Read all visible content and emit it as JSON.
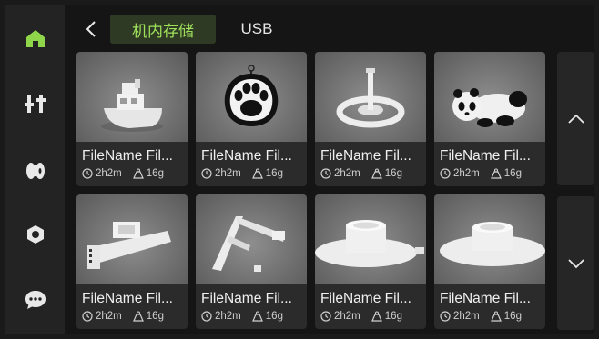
{
  "sidebar": {
    "items": [
      {
        "icon": "home-icon",
        "active": true
      },
      {
        "icon": "sliders-icon",
        "active": false
      },
      {
        "icon": "filament-spool-icon",
        "active": false
      },
      {
        "icon": "nut-settings-icon",
        "active": false
      },
      {
        "icon": "chat-bubble-icon",
        "active": false
      }
    ]
  },
  "header": {
    "tabs": [
      {
        "label": "机内存储",
        "active": true
      },
      {
        "label": "USB",
        "active": false
      }
    ]
  },
  "files": [
    {
      "name": "FileName Fil...",
      "time": "2h2m",
      "weight": "16g",
      "preview": "benchy-boat"
    },
    {
      "name": "FileName Fil...",
      "time": "2h2m",
      "weight": "16g",
      "preview": "paw-keychain"
    },
    {
      "name": "FileName Fil...",
      "time": "2h2m",
      "weight": "16g",
      "preview": "spinning-top"
    },
    {
      "name": "FileName Fil...",
      "time": "2h2m",
      "weight": "16g",
      "preview": "panda"
    },
    {
      "name": "FileName Fil...",
      "time": "2h2m",
      "weight": "16g",
      "preview": "clip-part"
    },
    {
      "name": "FileName Fil...",
      "time": "2h2m",
      "weight": "16g",
      "preview": "bracket"
    },
    {
      "name": "FileName Fil...",
      "time": "2h2m",
      "weight": "16g",
      "preview": "spool-base"
    },
    {
      "name": "FileName Fil...",
      "time": "2h2m",
      "weight": "16g",
      "preview": "spool-base"
    }
  ],
  "colors": {
    "accent": "#9fe05a",
    "active_tab_bg": "#2f3a25",
    "sidebar_bg": "#232323",
    "card_bg": "#2b2b2b"
  }
}
